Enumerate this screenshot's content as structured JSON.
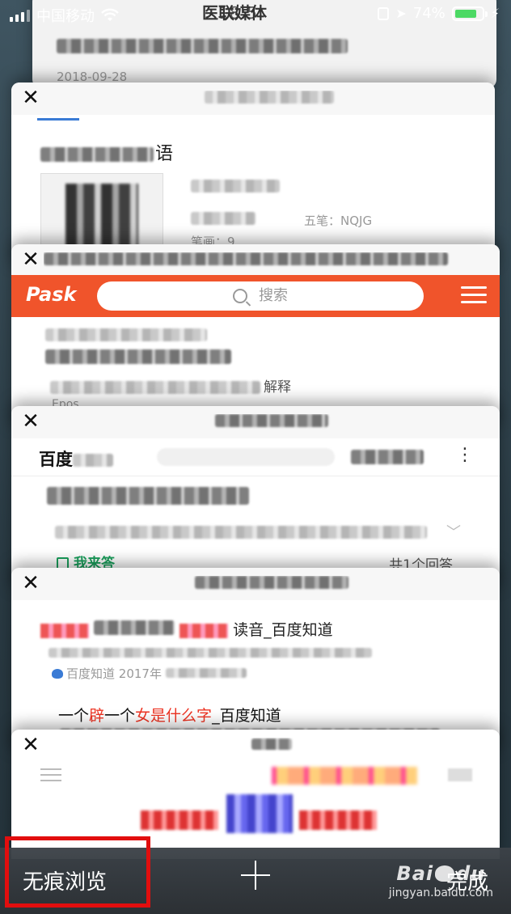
{
  "status_bar": {
    "carrier": "中国移动",
    "time": "18:5",
    "battery_percent": "74%",
    "battery_level": 0.74,
    "battery_color": "#4cd964"
  },
  "tabs": [
    {
      "title": "医联媒体",
      "date": "2018-09-28"
    },
    {
      "title": "",
      "meta_right": "五笔：NQJG",
      "stroke_label": "笔画：9",
      "heading_suffix": "语"
    },
    {
      "title": "",
      "site_logo": "Pask",
      "search_placeholder": "搜索",
      "snippet_suffix": "解释",
      "snippet_prefix": "Epos"
    },
    {
      "title": "",
      "brand": "百度",
      "answer_button": "我来答",
      "answer_count": "共1个回答"
    },
    {
      "title": "",
      "heading_suffix": "读音_百度知道",
      "source": "百度知道",
      "date_prefix": "2017年",
      "result_title_parts": [
        "一个",
        "辟",
        "一个",
        "女是什么字",
        "_百度知道"
      ]
    },
    {
      "title": ""
    }
  ],
  "toolbar": {
    "private_label": "无痕浏览",
    "done_label": "完成",
    "add_icon": "plus-icon"
  },
  "watermark": {
    "logo": "Bai",
    "logo_tail": "du",
    "sub": "jingyan.baidu.com"
  },
  "colors": {
    "accent_red": "#e20e0e",
    "ask_orange": "#f0542b",
    "baidu_green": "#1aa05c"
  }
}
